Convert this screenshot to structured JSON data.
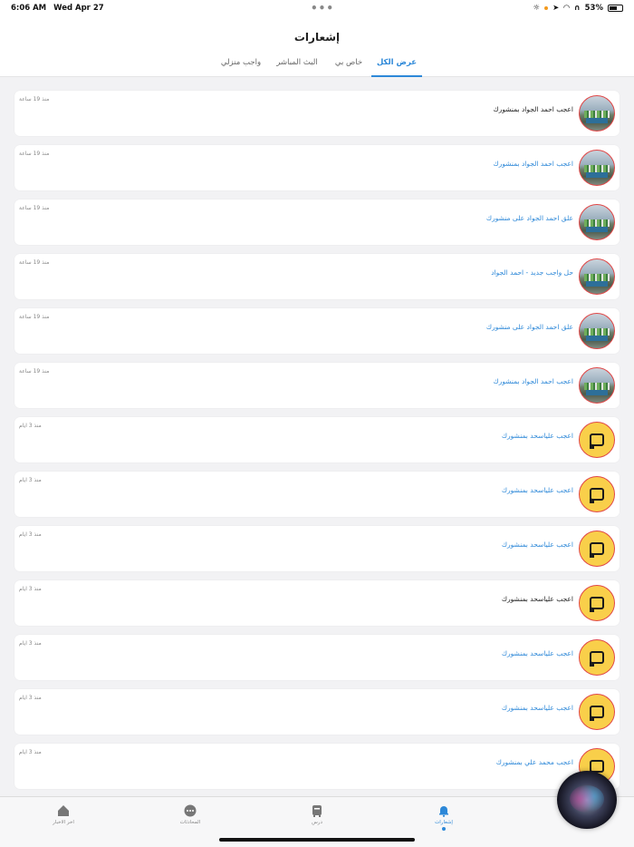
{
  "status_bar": {
    "time": "6:06 AM",
    "date": "Wed Apr 27",
    "battery": "53%"
  },
  "header": {
    "title": "إشعارات"
  },
  "tabs": [
    {
      "label": "عرض الكل",
      "active": true
    },
    {
      "label": "خاص بي",
      "active": false
    },
    {
      "label": "البث المباشر",
      "active": false
    },
    {
      "label": "واجب منزلي",
      "active": false
    }
  ],
  "notifications": [
    {
      "text": "اعجب احمد الجواد بمنشورك",
      "time": "منذ 19 ساعة",
      "avatar": "photo",
      "read": true
    },
    {
      "text": "اعجب احمد الجواد بمنشورك",
      "time": "منذ 19 ساعة",
      "avatar": "photo",
      "read": false
    },
    {
      "text": "علق احمد الجواد على منشورك",
      "time": "منذ 19 ساعة",
      "avatar": "photo",
      "read": false
    },
    {
      "text": "حل واجب جديد - احمد الجواد",
      "time": "منذ 19 ساعة",
      "avatar": "photo",
      "read": false
    },
    {
      "text": "علق احمد الجواد على منشورك",
      "time": "منذ 19 ساعة",
      "avatar": "photo",
      "read": false
    },
    {
      "text": "اعجب احمد الجواد بمنشورك",
      "time": "منذ 19 ساعة",
      "avatar": "photo",
      "read": false
    },
    {
      "text": "اعجب علياسحد بمنشورك",
      "time": "منذ 3 ايام",
      "avatar": "logo",
      "read": false
    },
    {
      "text": "اعجب علياسحد بمنشورك",
      "time": "منذ 3 ايام",
      "avatar": "logo",
      "read": false
    },
    {
      "text": "اعجب علياسحد بمنشورك",
      "time": "منذ 3 ايام",
      "avatar": "logo",
      "read": false
    },
    {
      "text": "اعجب علياسحد بمنشورك",
      "time": "منذ 3 ايام",
      "avatar": "logo",
      "read": true
    },
    {
      "text": "اعجب علياسحد بمنشورك",
      "time": "منذ 3 ايام",
      "avatar": "logo",
      "read": false
    },
    {
      "text": "اعجب علياسحد بمنشورك",
      "time": "منذ 3 ايام",
      "avatar": "logo",
      "read": false
    },
    {
      "text": "اعجب محمد علي بمنشورك",
      "time": "منذ 3 ايام",
      "avatar": "logo",
      "read": false
    }
  ],
  "tabbar": [
    {
      "label": "اخر الاخبار",
      "icon": "home-icon",
      "active": false
    },
    {
      "label": "المحادثات",
      "icon": "chat-icon",
      "active": false
    },
    {
      "label": "درس",
      "icon": "lesson-icon",
      "active": false
    },
    {
      "label": "إشعارات",
      "icon": "bell-icon",
      "active": true
    }
  ],
  "colors": {
    "accent": "#2d88d8",
    "unread_text": "#2d88d8",
    "avatar_border": "#e04646",
    "logo_bg": "#f9cf4a"
  }
}
